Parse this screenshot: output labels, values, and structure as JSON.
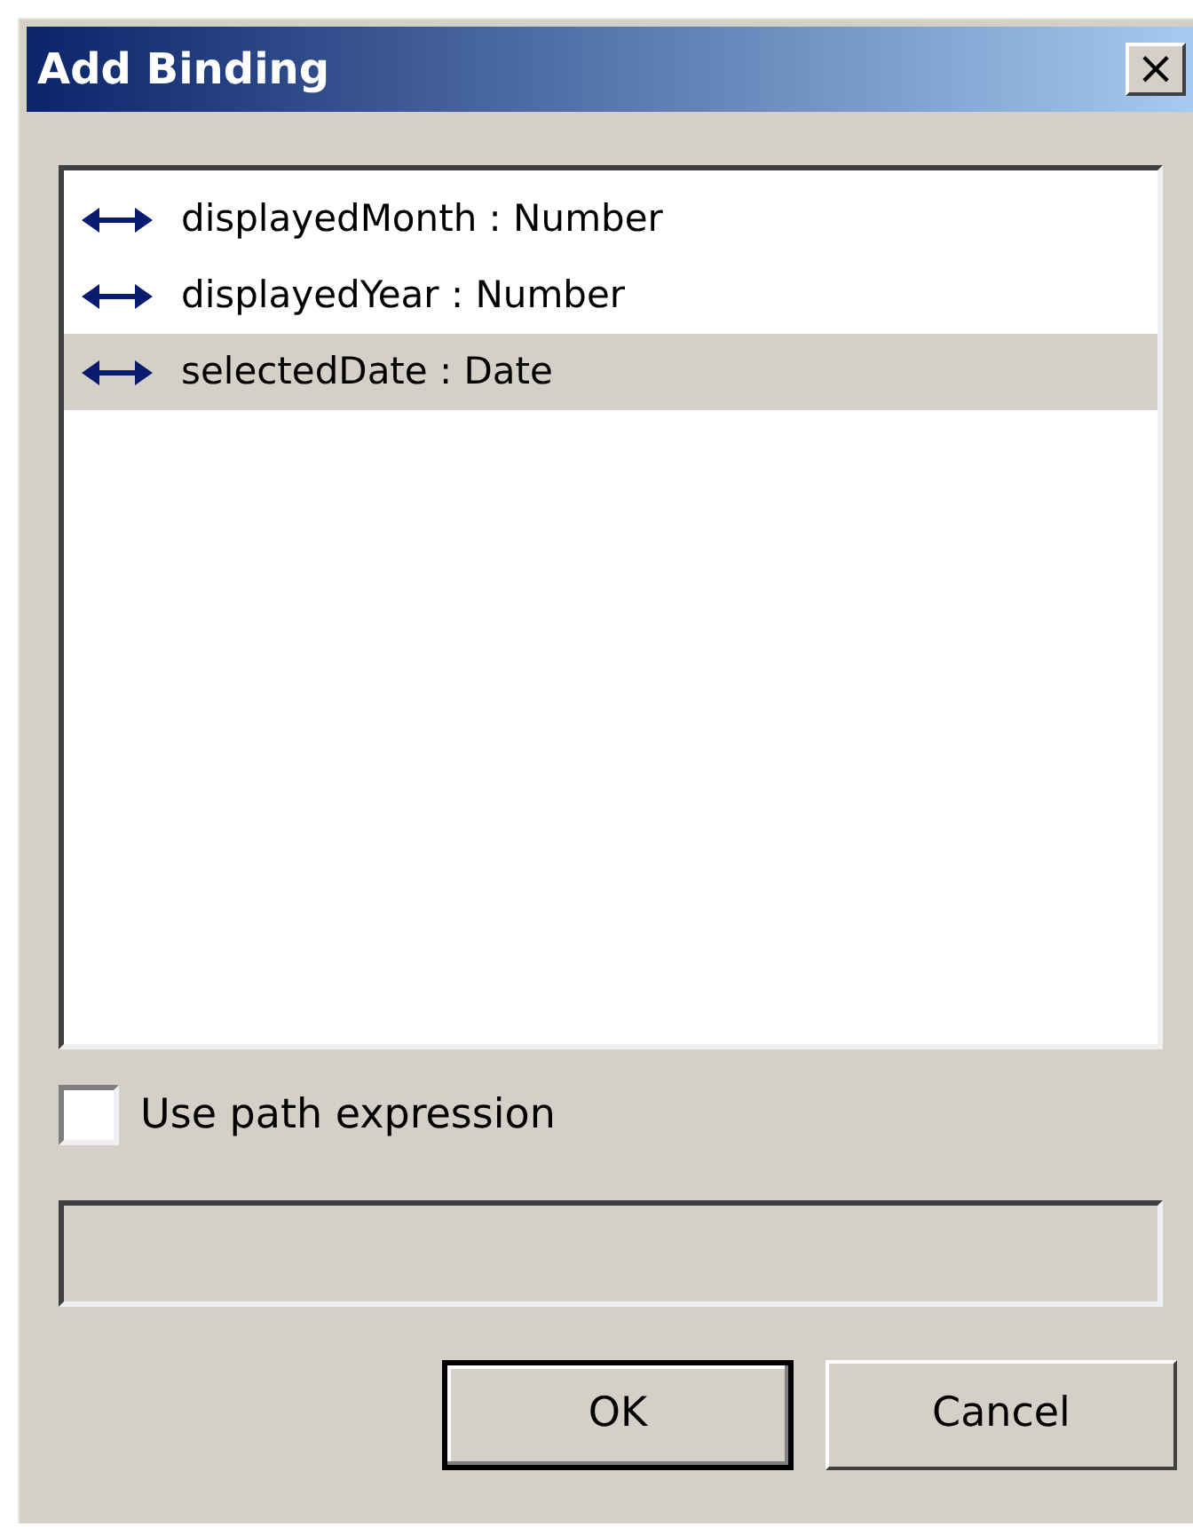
{
  "window": {
    "title": "Add Binding",
    "close": "×"
  },
  "bindings": [
    {
      "label": "displayedMonth : Number",
      "selected": false
    },
    {
      "label": "displayedYear : Number",
      "selected": false
    },
    {
      "label": "selectedDate : Date",
      "selected": true
    }
  ],
  "use_path_expression": {
    "label": "Use path expression",
    "checked": false
  },
  "path_field": {
    "disabled": true
  },
  "buttons": [
    {
      "label": "OK",
      "default": true
    },
    {
      "label": "Cancel",
      "default": false
    }
  ]
}
